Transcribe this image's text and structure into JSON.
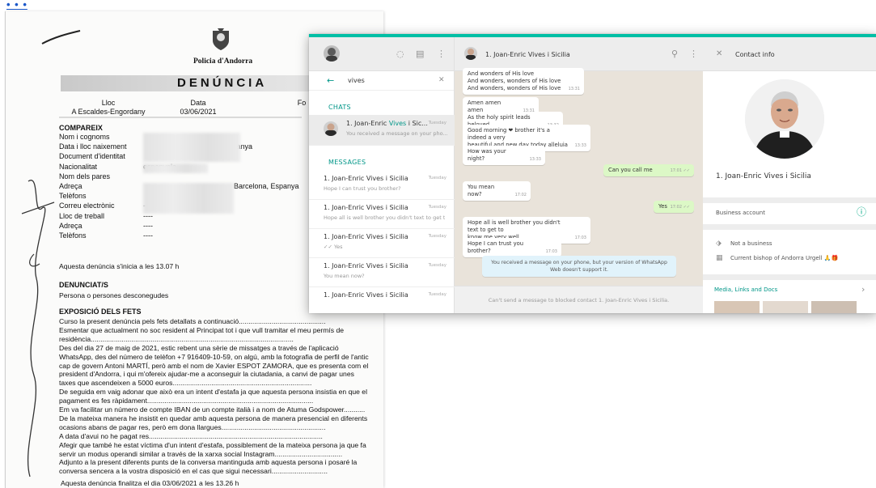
{
  "top_link": "• • •",
  "document": {
    "police_name": "Policia d'Andorra",
    "title": "DENÚNCIA",
    "header_fields": [
      {
        "label": "Lloc",
        "value": "A Escaldes-Engordany"
      },
      {
        "label": "Data",
        "value": "03/06/2021"
      },
      {
        "label": "Fo",
        "value": ""
      }
    ],
    "section_compareix": "COMPAREIX",
    "compareix_rows": [
      {
        "label": "Nom i cognoms",
        "value": ""
      },
      {
        "label": "Data i lloc naixement",
        "value": "Espanya"
      },
      {
        "label": "Document d'identitat",
        "value": ""
      },
      {
        "label": "Nacionalitat",
        "value": "espanyola"
      },
      {
        "label": "Nom dels pares",
        "value": ""
      },
      {
        "label": "Adreça",
        "value": "Barcelona, Espanya"
      },
      {
        "label": "Telèfons",
        "value": ""
      },
      {
        "label": "Correu electrònic",
        "value": "----"
      },
      {
        "label": "Lloc de treball",
        "value": "----"
      },
      {
        "label": "Adreça",
        "value": "----"
      },
      {
        "label": "Telèfons",
        "value": "----"
      }
    ],
    "start_line": "Aquesta denúncia s'inicia a les 13.07 h",
    "section_denunciats": "DENUNCIAT/S",
    "denunciats_value": "Persona o persones desconegudes",
    "section_exposicio": "EXPOSICIÓ DELS FETS",
    "body_lines": [
      "Curso la present denúncia pels fets detallats a continuació.............................................",
      "Esmentar que actualment no soc resident al Principat tot i que vull tramitar el meu permís de",
      "residència.........................................................................................................",
      "Des del dia 27 de maig de 2021, estic rebent una sèrie de missatges a través de l'aplicació",
      "WhatsApp, des del número de telèfon +7 916409-10-59, on algú, amb la fotografia de perfil de l'antic",
      "cap de govern Antoni MARTÍ, però amb el nom de Xavier ESPOT ZAMORA, que es presenta com el",
      "president d'Andorra, i qui m'ofereix ajudar-me a aconseguir la ciutadania, a canvi de pagar unes",
      "taxes que ascendeixen a 5000 euros........................................................................",
      "De seguida em vaig adonar que això era un intent d'estafa ja que aquesta persona insistia en que el",
      "pagament es fes ràpidament......................................................................................",
      "Em va facilitar  un número de compte IBAN de un compte italià i a nom de Atuma Godspower...........",
      "De la mateixa manera he insistit en quedar amb aquesta persona de manera presencial en diferents",
      "ocasions abans de pagar res, però em dona llargues......................................................",
      "A data d'avui no he pagat res..........................................................................................",
      "Afegir que també he estat víctima d'un intent d'estafa, possiblement de la mateixa persona ja que fa",
      "servir un modus operandi similar a través de la xarxa social Instagram...................................",
      "Adjunto a la present diferents punts de la conversa mantinguda amb aquesta persona i posaré la",
      "conversa sencera a la vostra disposició en el cas que sigui necessari............................."
    ],
    "end_line": "Aquesta denúncia finalitza el dia 03/06/2021 a les 13.26 h"
  },
  "whatsapp": {
    "search_value": "vives",
    "chats_label": "CHATS",
    "messages_label": "MESSAGES",
    "chats": [
      {
        "name_pre": "1. Joan-Enric ",
        "name_hl": "Vives",
        "name_post": " i Sic...",
        "time": "Tuesday",
        "sub": "You received a message on your pho..."
      }
    ],
    "message_results": [
      {
        "name": "1. Joan-Enric Vives i Sicilia",
        "time": "Tuesday",
        "sub": "Hope I can trust you brother?"
      },
      {
        "name": "1. Joan-Enric Vives i Sicilia",
        "time": "Tuesday",
        "sub": "Hope all is well brother you didn't text to get to..."
      },
      {
        "name": "1. Joan-Enric Vives i Sicilia",
        "time": "Tuesday",
        "sub": "✓✓ Yes"
      },
      {
        "name": "1. Joan-Enric Vives i Sicilia",
        "time": "Tuesday",
        "sub": "You mean now?"
      },
      {
        "name": "1. Joan-Enric Vives i Sicilia",
        "time": "Tuesday",
        "sub": ""
      }
    ],
    "conversation": {
      "contact_name": "1. Joan-Enric Vives i Sicilia",
      "messages": [
        {
          "dir": "in",
          "text": "And wonders of His love\nAnd wonders, wonders of His love\nAnd wonders, wonders of His love",
          "time": "13:31"
        },
        {
          "dir": "in",
          "text": "Amen amen amen",
          "time": "13:31"
        },
        {
          "dir": "in",
          "text": "As the holy spirit leads beloved",
          "time": "13:32"
        },
        {
          "dir": "in",
          "text": "Good morning ❤ brother it's a indeed a very\nbeautiful and new day today alleluia",
          "time": "13:33"
        },
        {
          "dir": "in",
          "text": "How was your night?",
          "time": "13:33"
        },
        {
          "dir": "out",
          "text": "Can you call me",
          "time": "17:01 ✓✓"
        },
        {
          "dir": "in",
          "text": "You mean now?",
          "time": "17:02"
        },
        {
          "dir": "out",
          "text": "Yes",
          "time": "17:02 ✓✓"
        },
        {
          "dir": "in",
          "text": "Hope all is well brother you didn't text to get to\nknow me very well",
          "time": "17:03"
        },
        {
          "dir": "in",
          "text": "Hope I can trust you brother?",
          "time": "17:03"
        }
      ],
      "system_message": "You received a message on your phone, but your version of WhatsApp Web doesn't support it.",
      "footer": "Can't send a message to blocked contact 1. Joan-Enric Vives i Sicilia."
    },
    "contact_info": {
      "title": "Contact info",
      "name": "1. Joan-Enric Vives i Sicilia",
      "business_label": "Business account",
      "business_type": "Not a business",
      "description": "Current bishop of Andorra Urgell 🙏🎁",
      "media_link": "Media, Links and Docs"
    },
    "colors": {
      "accent": "#00bfa5",
      "teal_text": "#009688",
      "outgoing_bubble": "#dcf8c6",
      "chat_bg": "#e9e3da"
    }
  }
}
